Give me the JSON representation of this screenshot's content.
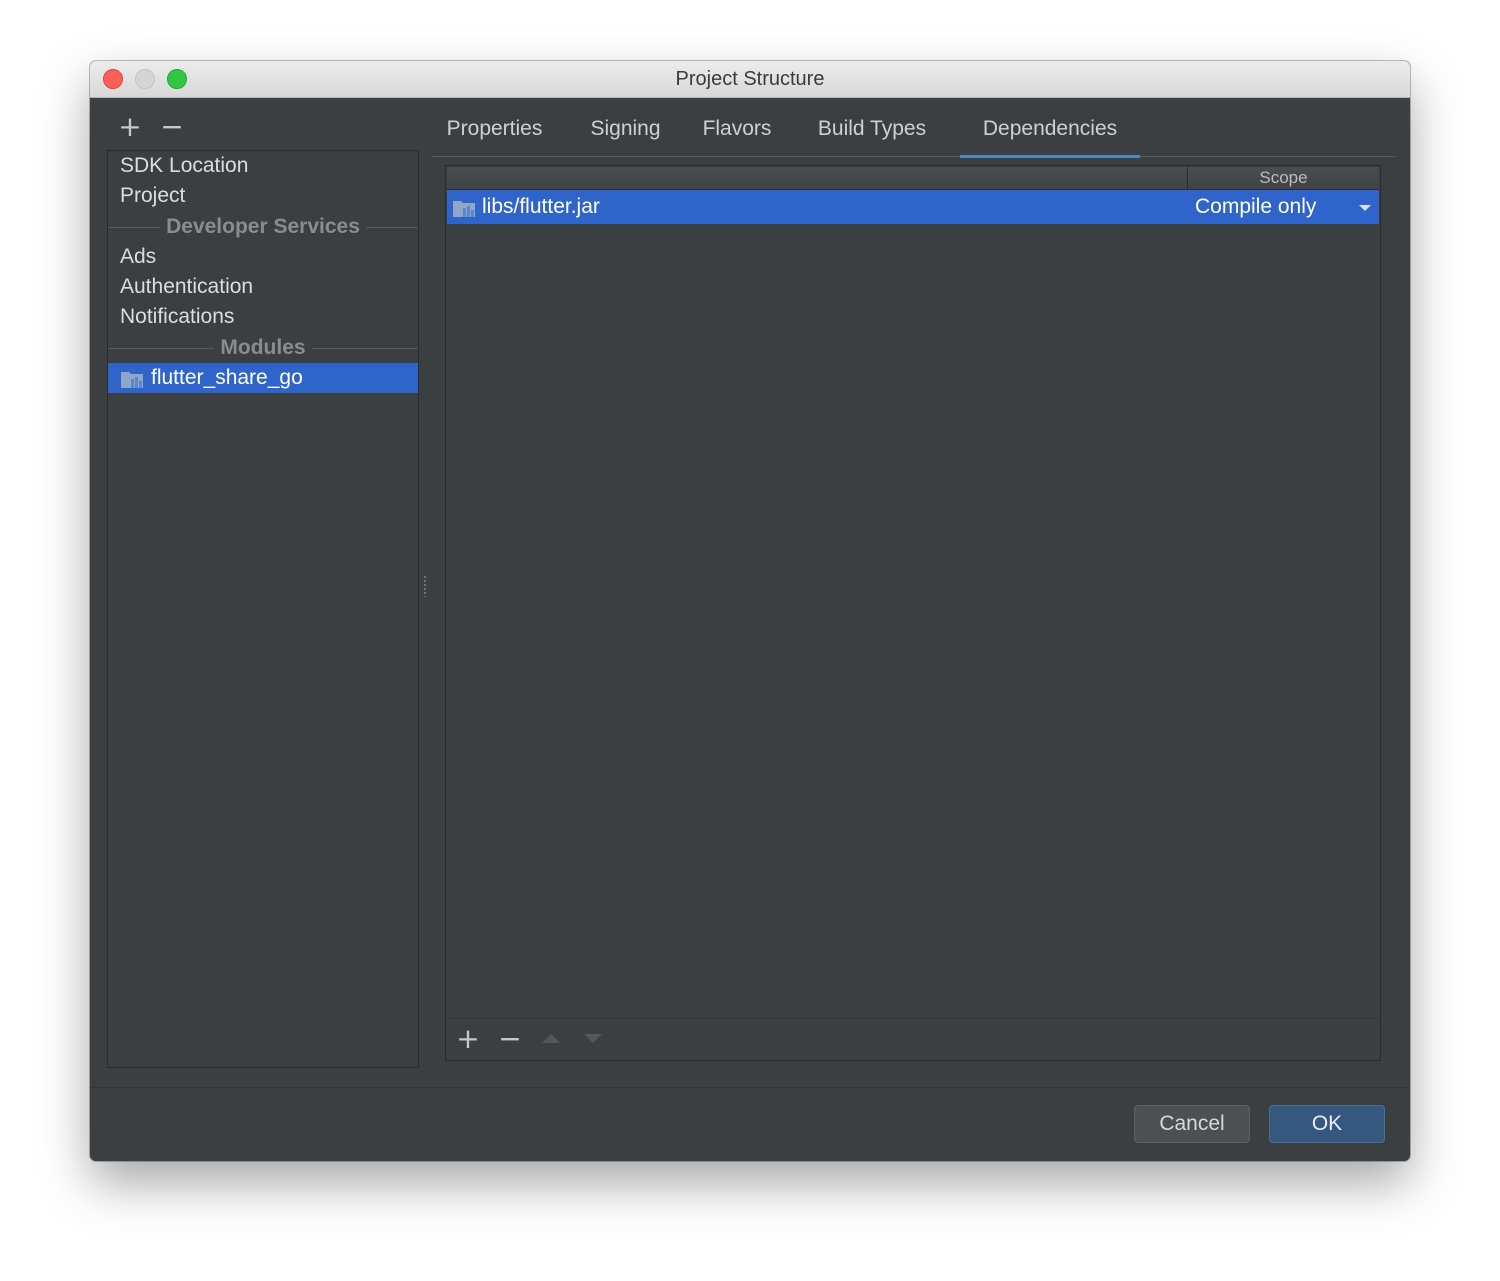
{
  "window": {
    "title": "Project Structure"
  },
  "left_toolbar": {
    "add": "+",
    "remove": "−"
  },
  "sidebar": {
    "items": [
      {
        "label": "SDK Location"
      },
      {
        "label": "Project"
      }
    ],
    "section_developer_services": "Developer Services",
    "services": [
      {
        "label": "Ads"
      },
      {
        "label": "Authentication"
      },
      {
        "label": "Notifications"
      }
    ],
    "section_modules": "Modules",
    "modules": [
      {
        "label": "flutter_share_go",
        "selected": true
      }
    ]
  },
  "tabs": [
    {
      "label": "Properties"
    },
    {
      "label": "Signing"
    },
    {
      "label": "Flavors"
    },
    {
      "label": "Build Types"
    },
    {
      "label": "Dependencies",
      "active": true
    }
  ],
  "dependencies": {
    "columns": [
      "",
      "Scope"
    ],
    "rows": [
      {
        "name": "libs/flutter.jar",
        "scope": "Compile only"
      }
    ],
    "toolbar": {
      "add": "+",
      "remove": "−"
    }
  },
  "buttons": {
    "cancel": "Cancel",
    "ok": "OK"
  },
  "colors": {
    "selection": "#2f65ca",
    "background": "#3c3f41",
    "tab_underline": "#4a88c7"
  }
}
